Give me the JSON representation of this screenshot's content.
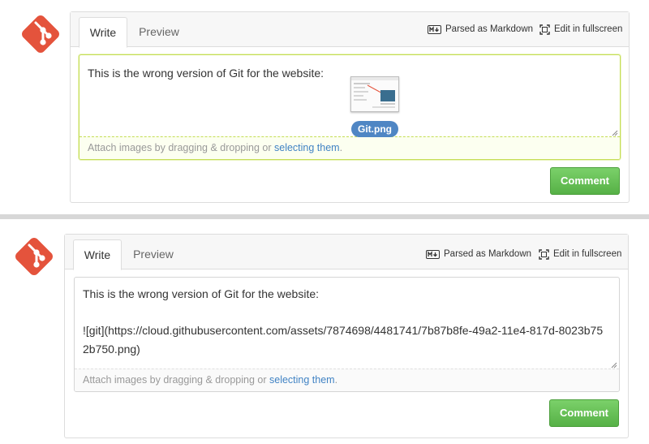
{
  "colors": {
    "git_logo": "#e4533c",
    "link": "#4183c4",
    "comment_button": "#5cb74b",
    "file_badge": "#4f86c4",
    "focus_border": "#c5dd55"
  },
  "icons": {
    "logo": "git-logo-icon",
    "markdown": "markdown-icon",
    "fullscreen": "fullscreen-icon",
    "resize": "resize-grip-icon"
  },
  "top": {
    "tabs": [
      {
        "label": "Write"
      },
      {
        "label": "Preview"
      }
    ],
    "toolbar": {
      "markdown_label": "Parsed as Markdown",
      "fullscreen_label": "Edit in fullscreen"
    },
    "editor": {
      "text": "This is the wrong version of Git for the website:",
      "attachment_name": "Git.png"
    },
    "attach": {
      "prefix": "Attach images by dragging & dropping or ",
      "link": "selecting them",
      "suffix": "."
    },
    "comment_label": "Comment"
  },
  "bottom": {
    "tabs": [
      {
        "label": "Write"
      },
      {
        "label": "Preview"
      }
    ],
    "toolbar": {
      "markdown_label": "Parsed as Markdown",
      "fullscreen_label": "Edit in fullscreen"
    },
    "editor": {
      "text": "This is the wrong version of Git for the website:\n\n![git](https://cloud.githubusercontent.com/assets/7874698/4481741/7b87b8fe-49a2-11e4-817d-8023b752b750.png)"
    },
    "attach": {
      "prefix": "Attach images by dragging & dropping or ",
      "link": "selecting them",
      "suffix": "."
    },
    "comment_label": "Comment"
  }
}
